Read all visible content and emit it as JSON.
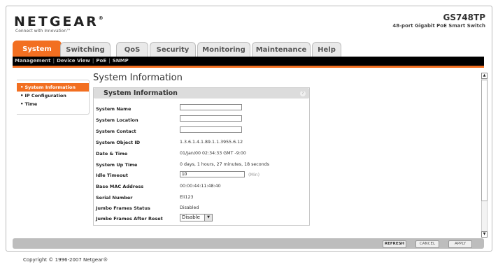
{
  "header": {
    "logo": "NETGEAR",
    "logo_mark": "®",
    "tagline": "Connect with Innovation™",
    "model": "GS748TP",
    "model_desc": "48-port Gigabit PoE Smart Switch"
  },
  "tabs": [
    {
      "label": "System"
    },
    {
      "label": "Switching"
    },
    {
      "label": "QoS"
    },
    {
      "label": "Security"
    },
    {
      "label": "Monitoring"
    },
    {
      "label": "Maintenance"
    },
    {
      "label": "Help"
    }
  ],
  "subnav": [
    "Management",
    "Device View",
    "PoE",
    "SNMP"
  ],
  "leftnav": [
    {
      "label": "System Information"
    },
    {
      "label": "IP Configuration"
    },
    {
      "label": "Time"
    }
  ],
  "page_title": "System Information",
  "panel": {
    "title": "System Information",
    "help_icon": "?",
    "rows": [
      {
        "label": "System Name",
        "value": ""
      },
      {
        "label": "System Location",
        "value": ""
      },
      {
        "label": "System Contact",
        "value": ""
      },
      {
        "label": "System Object ID",
        "value": "1.3.6.1.4.1.89.1.1.3955.6.12"
      },
      {
        "label": "Date & Time",
        "value": "01/Jan/00  02:34:33 GMT -9:00"
      },
      {
        "label": "System Up Time",
        "value": "0 days, 1 hours, 27 minutes, 18 seconds"
      },
      {
        "label": "Idle Timeout",
        "value": "10",
        "unit": "(Min)"
      },
      {
        "label": "Base MAC Address",
        "value": "00:00:44:11:48:40"
      },
      {
        "label": "Serial Number",
        "value": "Eli123"
      },
      {
        "label": "Jumbo Frames Status",
        "value": "Disabled"
      },
      {
        "label": "Jumbo Frames After Reset",
        "value": "Disable"
      }
    ]
  },
  "buttons": {
    "refresh": "REFRESH",
    "cancel": "CANCEL",
    "apply": "APPLY"
  },
  "scrollbar": {
    "up": "▲",
    "down": "▼"
  },
  "dropdown_arrow": "▼",
  "bullet": "•",
  "copyright": "Copyright © 1996-2007 Netgear®",
  "colors": {
    "accent": "#f26f21",
    "subnav_bg": "#000000",
    "panel_header": "#dcdcdc"
  }
}
